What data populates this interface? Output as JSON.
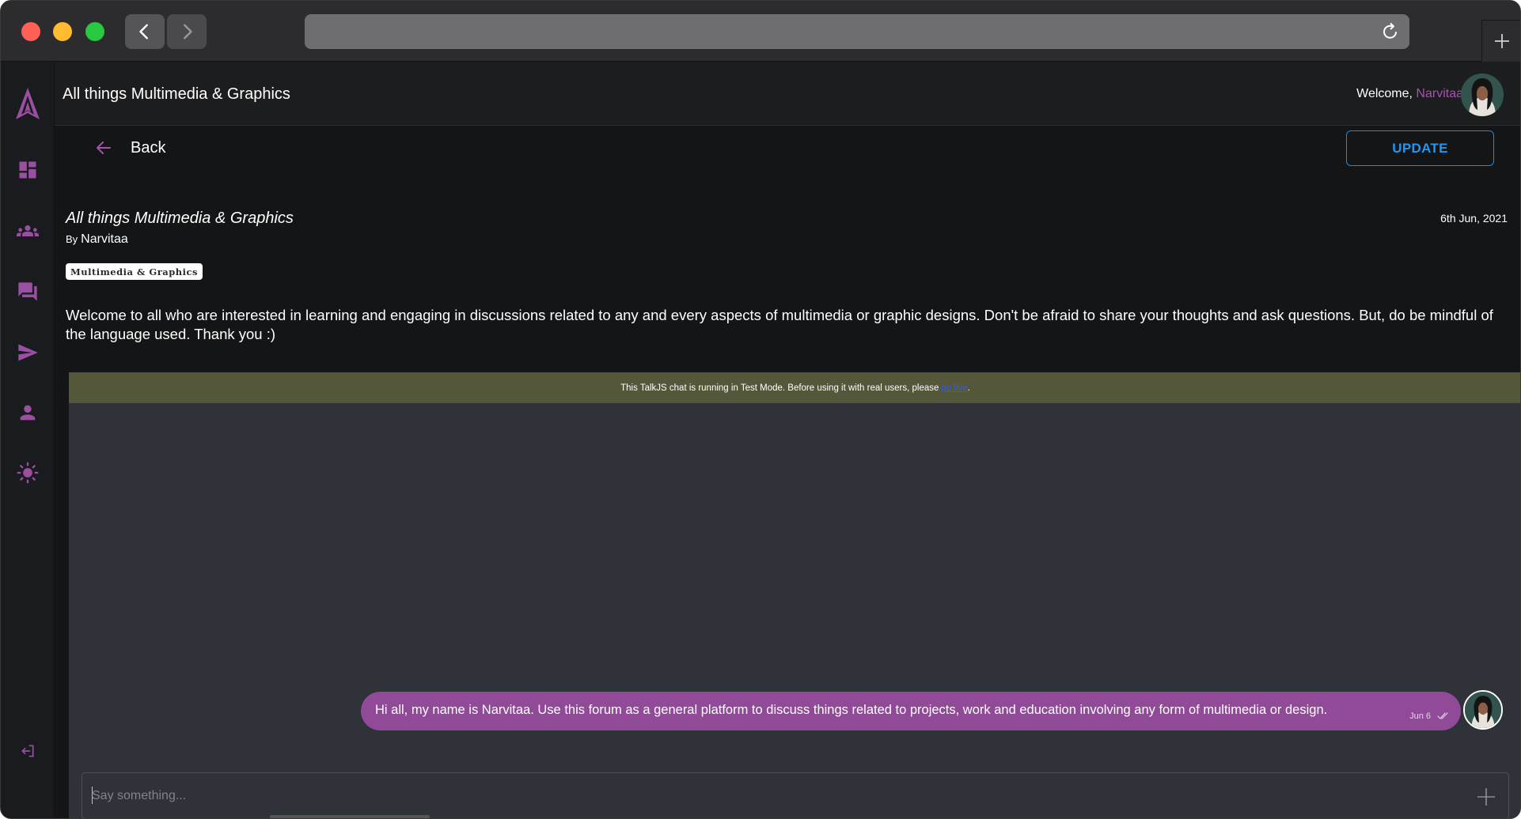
{
  "app": {
    "title": "All things Multimedia & Graphics",
    "welcome_prefix": "Welcome, ",
    "user_name": "Narvitaa"
  },
  "nav": {
    "back_label": "Back",
    "update_label": "UPDATE"
  },
  "sidebar": {
    "items": [
      {
        "icon": "logo-icon"
      },
      {
        "icon": "dashboard-icon"
      },
      {
        "icon": "groups-icon"
      },
      {
        "icon": "forum-icon"
      },
      {
        "icon": "send-icon"
      },
      {
        "icon": "person-icon"
      },
      {
        "icon": "theme-toggle-icon"
      },
      {
        "icon": "logout-icon"
      }
    ]
  },
  "post": {
    "title": "All things Multimedia & Graphics",
    "by_label": "By",
    "author": "Narvitaa",
    "date": "6th Jun, 2021",
    "tag": "Multimedia & Graphics",
    "body": "Welcome to all who are interested in learning and engaging in discussions related to any and every aspects of multimedia or graphic designs. Don't be afraid to share your thoughts and ask questions. But, do be mindful of the language used. Thank you :)"
  },
  "chat": {
    "test_mode_text": "This TalkJS chat is running in Test Mode. Before using it with real users, please",
    "test_mode_link": "go live",
    "test_mode_suffix": ".",
    "message": {
      "text": "Hi all, my name is Narvitaa. Use this forum as a general platform to discuss things related to projects, work and education involving any form of multimedia or design.",
      "time": "Jun 6"
    },
    "composer_placeholder": "Say something..."
  },
  "colors": {
    "accent_purple": "#a454a9",
    "bubble_purple": "#904a98",
    "update_blue": "#2196f3",
    "test_bar": "#55573a",
    "chat_bg": "#2f3238"
  }
}
